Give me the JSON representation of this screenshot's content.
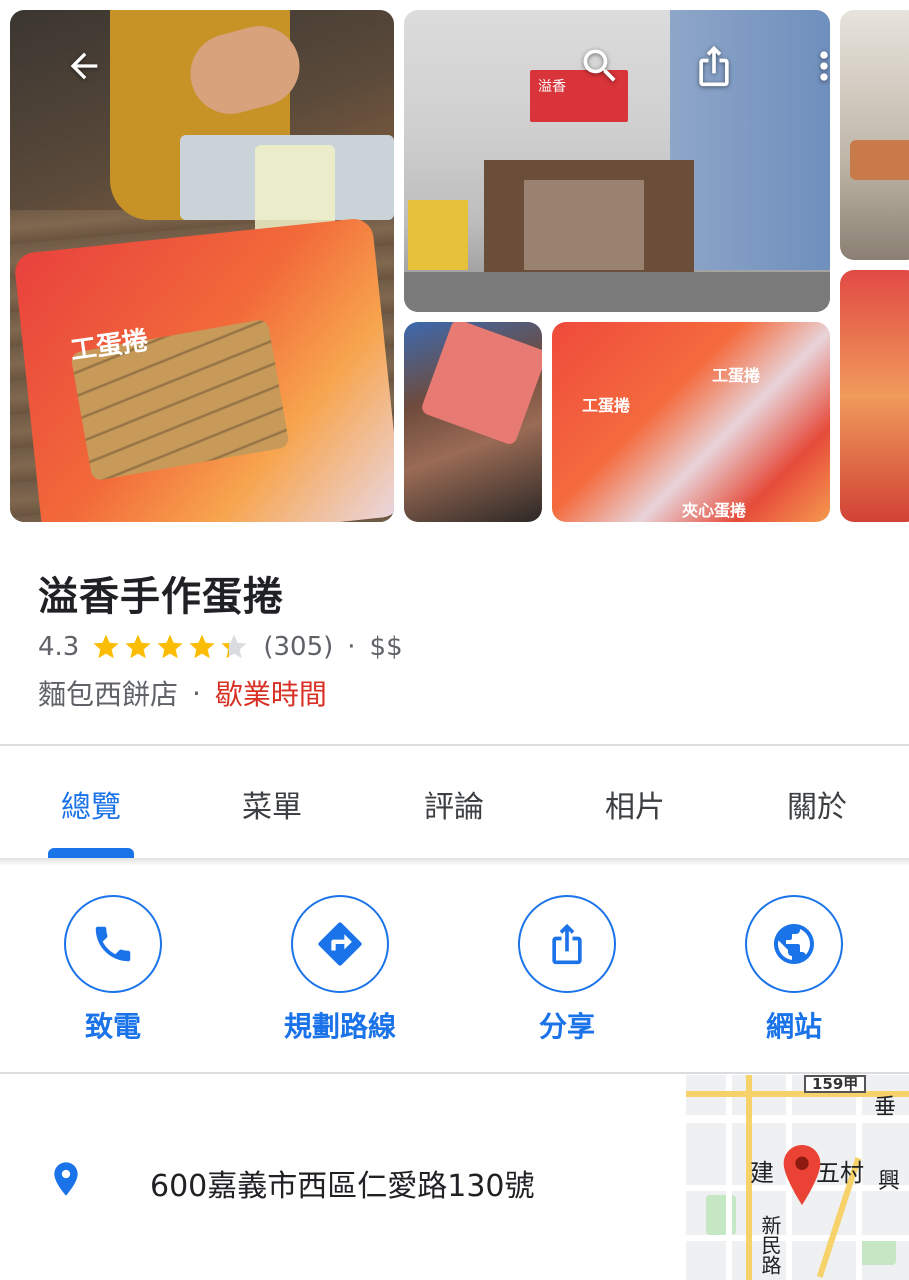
{
  "toolbar": {
    "back_icon": "arrow-back-icon",
    "search_icon": "search-icon",
    "share_icon": "share-icon",
    "more_icon": "more-vert-icon"
  },
  "photos": {
    "main_bag_text": "工蛋捲",
    "store_sign_text": "溢香",
    "thumb_label_1": "工蛋捲",
    "thumb_label_2": "夾心蛋捲"
  },
  "place": {
    "name": "溢香手作蛋捲",
    "rating": "4.3",
    "stars_value": 4.3,
    "reviews": "(305)",
    "separator": "·",
    "price": "$$",
    "category": "麵包西餅店",
    "status": "歇業時間"
  },
  "tabs": [
    {
      "label": "總覽",
      "active": true
    },
    {
      "label": "菜單",
      "active": false
    },
    {
      "label": "評論",
      "active": false
    },
    {
      "label": "相片",
      "active": false
    },
    {
      "label": "關於",
      "active": false
    }
  ],
  "actions": [
    {
      "label": "致電",
      "icon": "phone-icon"
    },
    {
      "label": "規劃路線",
      "icon": "directions-icon"
    },
    {
      "label": "分享",
      "icon": "share-icon"
    },
    {
      "label": "網站",
      "icon": "globe-icon"
    }
  ],
  "address": {
    "icon": "location-pin-icon",
    "text": "600嘉義市西區仁愛路130號"
  },
  "map": {
    "route_badge": "159甲",
    "label_1": "建",
    "label_2": "五村",
    "label_3": "興",
    "label_4": "垂",
    "label_5": "新民路"
  },
  "colors": {
    "accent": "#1a73e8",
    "closed": "#d93025",
    "star": "#fbbc04",
    "star_empty": "#dadce0"
  }
}
